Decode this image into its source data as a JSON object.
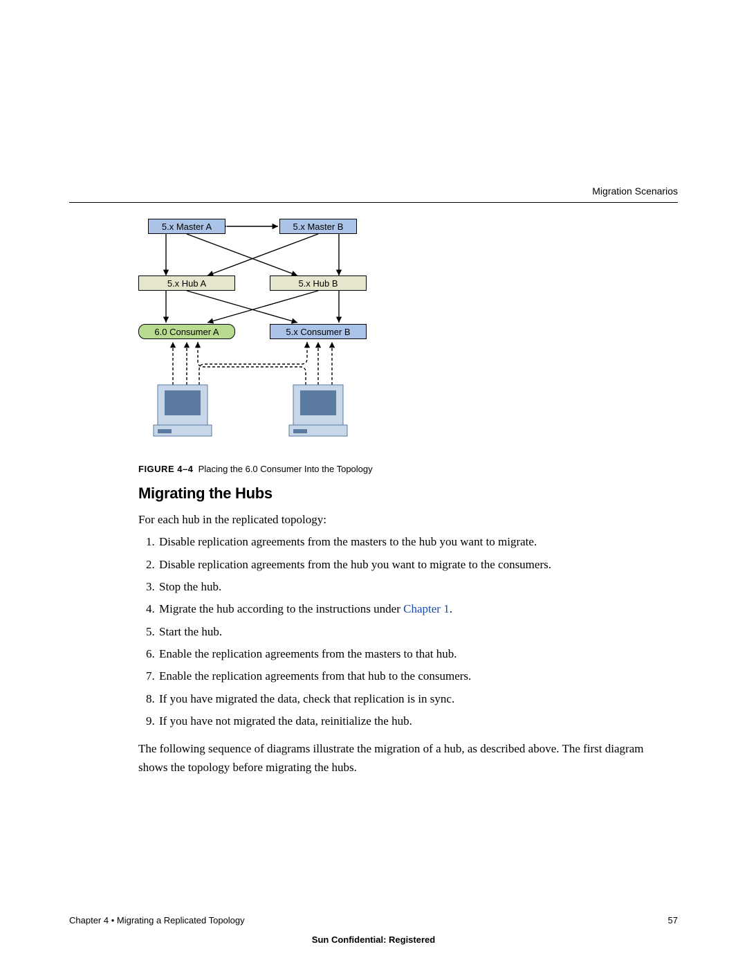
{
  "header": {
    "right": "Migration Scenarios"
  },
  "diagram": {
    "masterA": "5.x Master A",
    "masterB": "5.x Master B",
    "hubA": "5.x Hub A",
    "hubB": "5.x Hub B",
    "consA": "6.0 Consumer A",
    "consB": "5.x Consumer B"
  },
  "caption": {
    "label": "FIGURE 4–4",
    "text": "Placing the 6.0 Consumer Into the Topology"
  },
  "section": {
    "title": "Migrating the Hubs"
  },
  "intro": "For each hub in the replicated topology:",
  "steps": [
    "Disable replication agreements from the masters to the hub you want to migrate.",
    "Disable replication agreements from the hub you want to migrate to the consumers.",
    "Stop the hub.",
    "Migrate the hub according to the instructions under ",
    "Start the hub.",
    "Enable the replication agreements from the masters to that hub.",
    "Enable the replication agreements from that hub to the consumers.",
    "If you have migrated the data, check that replication is in sync.",
    "If you have not migrated the data, reinitialize the hub."
  ],
  "step4_link": "Chapter 1",
  "after": "The following sequence of diagrams illustrate the migration of a hub, as described above. The first diagram shows the topology before migrating the hubs.",
  "footer": {
    "left": "Chapter 4 • Migrating a Replicated Topology",
    "right": "57",
    "center": "Sun Confidential: Registered"
  }
}
